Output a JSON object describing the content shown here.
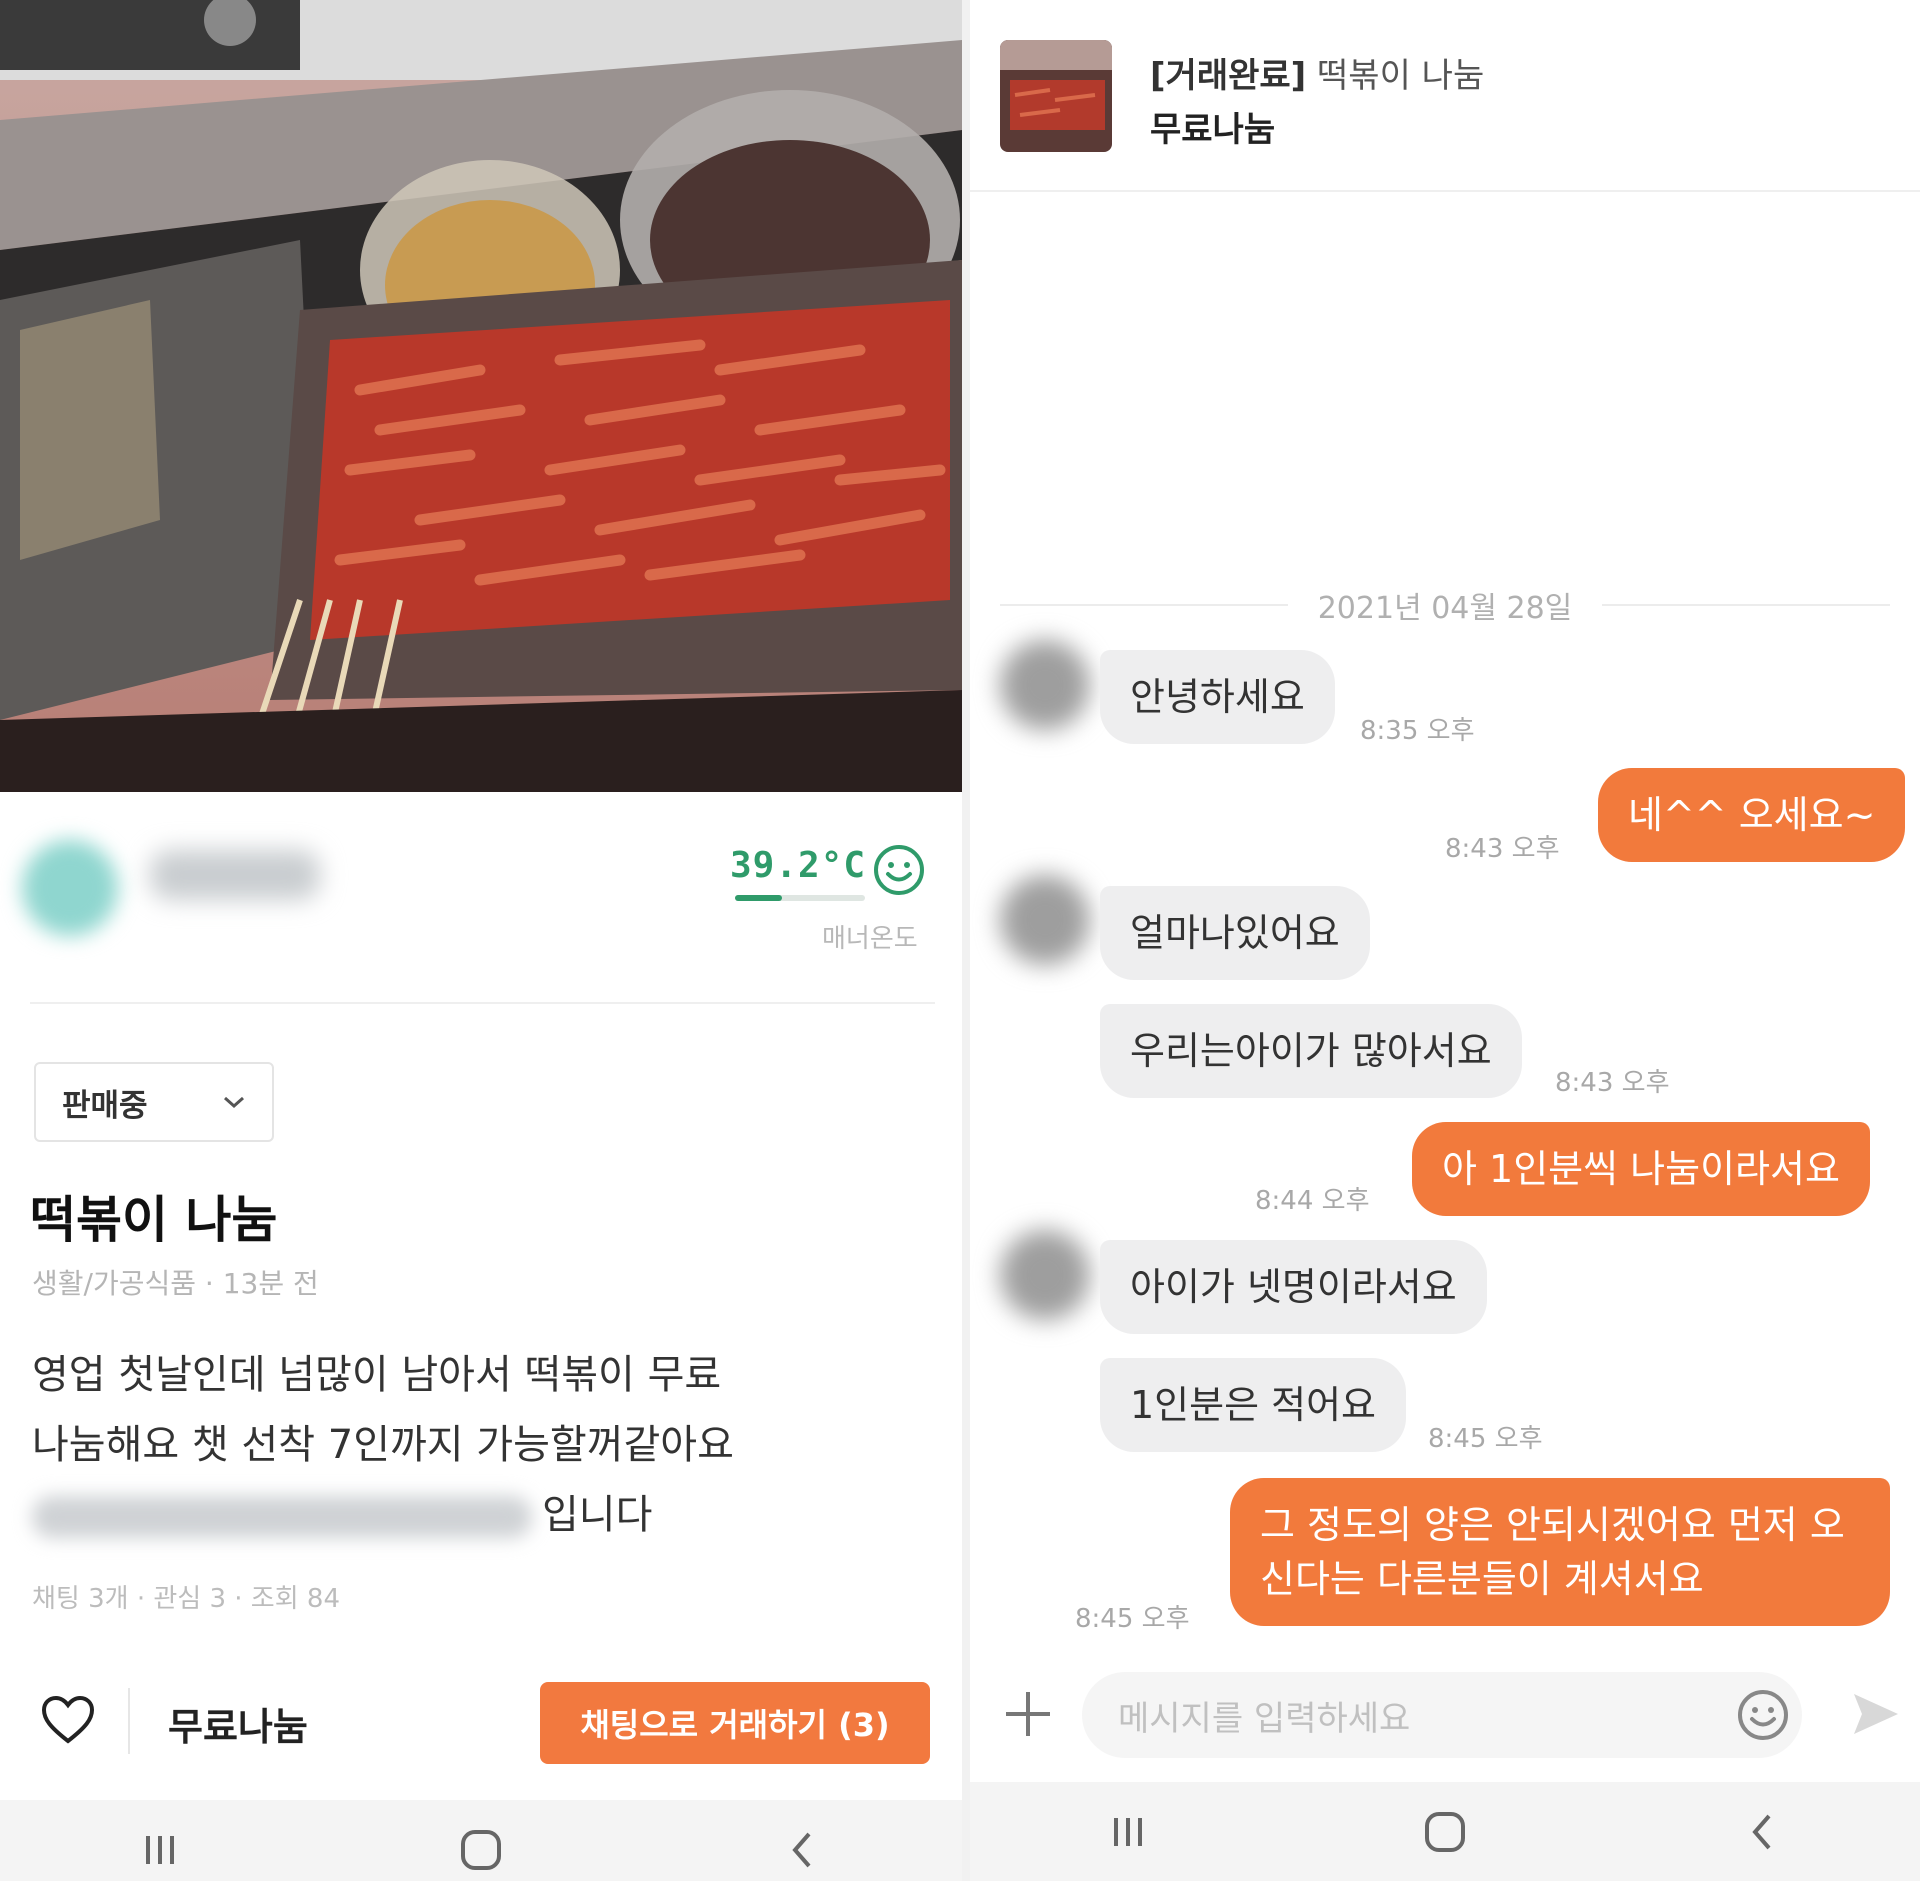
{
  "listing": {
    "manner_temp": "39.2°C",
    "manner_temp_fill": 0.36,
    "manner_label": "매너온도",
    "status": "판매중",
    "title": "떡볶이 나눔",
    "meta": "생활/가공식품 · 13분 전",
    "desc_line1": "영업 첫날인데  넘많이 남아서 떡볶이 무료",
    "desc_line2": "나눔해요   챗 선착 7인까지 가능할꺼같아요",
    "desc_line3_end": "입니다",
    "stats": "채팅 3개 · 관심 3 · 조회 84",
    "price": "무료나눔",
    "chat_button": "채팅으로 거래하기 (3)"
  },
  "chat": {
    "header_status": "[거래완료]",
    "header_title": "떡볶이 나눔",
    "header_price": "무료나눔",
    "date": "2021년 04월 28일",
    "messages": [
      {
        "dir": "in",
        "text": "안녕하세요",
        "time": "8:35 오후"
      },
      {
        "dir": "out",
        "text": "네^^ 오세요~",
        "time": "8:43 오후"
      },
      {
        "dir": "in",
        "text": "얼마나있어요",
        "time": ""
      },
      {
        "dir": "in",
        "text": "우리는아이가 많아서요",
        "time": "8:43 오후"
      },
      {
        "dir": "out",
        "text": "아 1인분씩 나눔이라서요",
        "time": "8:44 오후"
      },
      {
        "dir": "in",
        "text": "아이가 넷명이라서요",
        "time": ""
      },
      {
        "dir": "in",
        "text": "1인분은 적어요",
        "time": "8:45 오후"
      },
      {
        "dir": "out",
        "text": "그 정도의 양은 안되시겠어요 먼저 오신다는 다른분들이 계셔서요",
        "time": "8:45 오후"
      }
    ],
    "input_placeholder": "메시지를 입력하세요"
  },
  "icons": {
    "heart": "heart-icon",
    "smile": "smile-icon",
    "plus": "plus-icon",
    "emoji": "emoji-icon",
    "send": "send-icon",
    "chevron": "chevron-down-icon",
    "nav": [
      "recent-apps-icon",
      "home-icon",
      "back-icon"
    ]
  },
  "colors": {
    "accent": "#f2793f",
    "temperature": "#2f9b6a"
  }
}
